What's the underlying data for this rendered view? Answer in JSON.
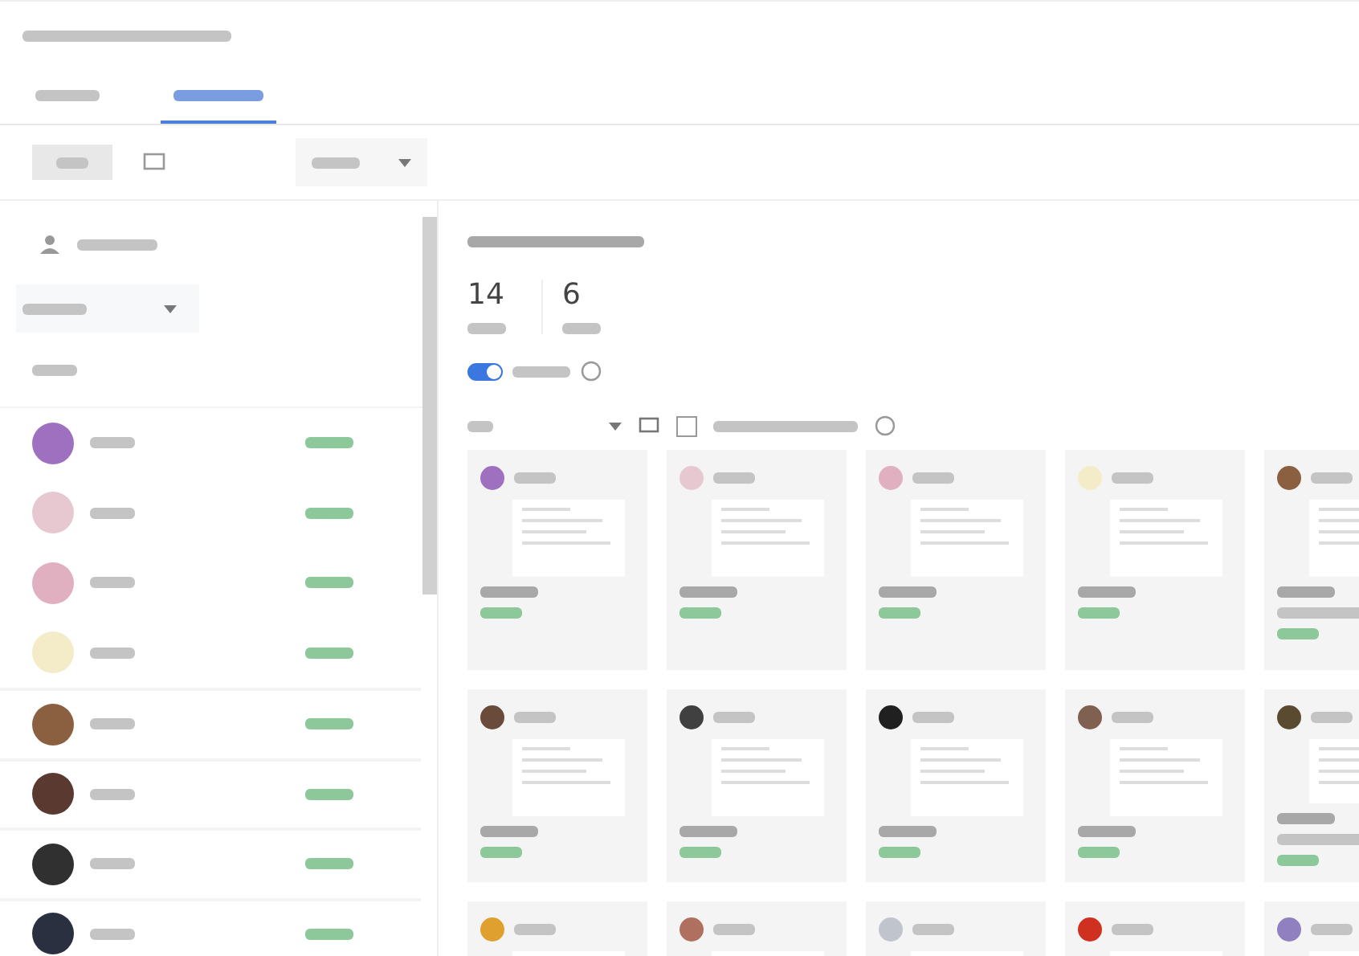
{
  "tabs": [
    {
      "selected": false
    },
    {
      "selected": true
    }
  ],
  "students": [
    {
      "color": "#a070c0"
    },
    {
      "color": "#e8c8d0"
    },
    {
      "color": "#e0b0c0"
    },
    {
      "color": "#f4ecc8"
    },
    {
      "color": "#8a6040"
    },
    {
      "color": "#5a3a30"
    },
    {
      "color": "#303030"
    },
    {
      "color": "#2a3040"
    }
  ],
  "stats": [
    "14",
    "6"
  ],
  "toggle": {
    "on": true
  },
  "checkbox": {
    "checked": false
  },
  "cards": [
    {
      "color": "#a070c0",
      "extra": false
    },
    {
      "color": "#e8c8d0",
      "extra": false
    },
    {
      "color": "#e0b0c0",
      "extra": false
    },
    {
      "color": "#f4ecc8",
      "extra": false
    },
    {
      "color": "#8a6040",
      "extra": true
    },
    {
      "color": "#6a4a3a",
      "extra": false
    },
    {
      "color": "#404040",
      "extra": false
    },
    {
      "color": "#202020",
      "extra": false
    },
    {
      "color": "#806050",
      "extra": false
    },
    {
      "color": "#5a4a30",
      "extra": true
    },
    {
      "color": "#e0a030"
    },
    {
      "color": "#b07060"
    },
    {
      "color": "#c0c4cc"
    },
    {
      "color": "#d03020"
    },
    {
      "color": "#9080c0"
    }
  ]
}
